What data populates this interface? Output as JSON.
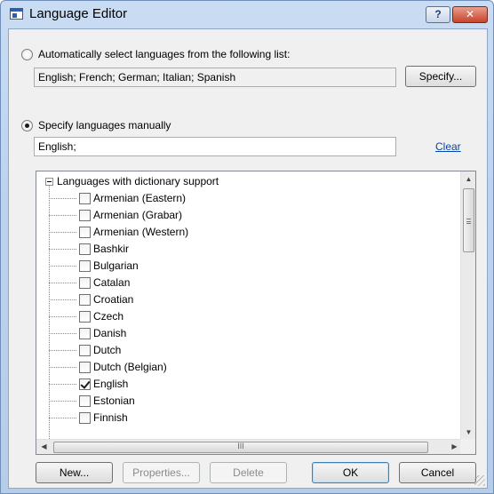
{
  "window": {
    "title": "Language Editor",
    "help_label": "?",
    "close_label": "✕"
  },
  "auto_select": {
    "label": "Automatically select languages from the following list:",
    "selected": false,
    "value": "English; French; German; Italian; Spanish",
    "specify_label": "Specify..."
  },
  "manual": {
    "label": "Specify languages manually",
    "selected": true,
    "value": "English;",
    "clear_label": "Clear"
  },
  "tree": {
    "root_label": "Languages with dictionary support",
    "items": [
      {
        "label": "Armenian (Eastern)",
        "checked": false
      },
      {
        "label": "Armenian (Grabar)",
        "checked": false
      },
      {
        "label": "Armenian (Western)",
        "checked": false
      },
      {
        "label": "Bashkir",
        "checked": false
      },
      {
        "label": "Bulgarian",
        "checked": false
      },
      {
        "label": "Catalan",
        "checked": false
      },
      {
        "label": "Croatian",
        "checked": false
      },
      {
        "label": "Czech",
        "checked": false
      },
      {
        "label": "Danish",
        "checked": false
      },
      {
        "label": "Dutch",
        "checked": false
      },
      {
        "label": "Dutch (Belgian)",
        "checked": false
      },
      {
        "label": "English",
        "checked": true
      },
      {
        "label": "Estonian",
        "checked": false
      },
      {
        "label": "Finnish",
        "checked": false
      }
    ],
    "hscroll_grip": "III"
  },
  "buttons": {
    "new": "New...",
    "properties": "Properties...",
    "delete": "Delete",
    "ok": "OK",
    "cancel": "Cancel"
  }
}
